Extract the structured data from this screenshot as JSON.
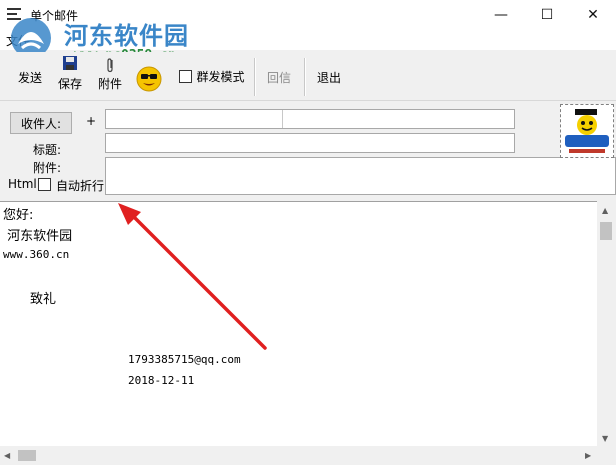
{
  "window": {
    "title": "单个邮件",
    "minimize_glyph": "—",
    "maximize_glyph": "☐",
    "close_glyph": "✕"
  },
  "menu": {
    "items": [
      {
        "label": "文件"
      }
    ]
  },
  "watermark": {
    "title": "河东软件园",
    "url": "www.pc0359.cn"
  },
  "toolbar": {
    "send_label": "发送",
    "save_label": "保存",
    "attach_label": "附件",
    "group_mode_label": "群发模式",
    "group_mode_checked": false,
    "reply_label": "回信",
    "reply_enabled": false,
    "exit_label": "退出"
  },
  "header": {
    "recipient_button_label": "收件人:",
    "plus_label": "+",
    "subject_label": "标题:",
    "attachment_label": "附件:",
    "html_label": "Html",
    "html_checked": false,
    "autowrap_label": "自动折行",
    "autowrap_checked": false,
    "recipient_value": "",
    "subject_value": "",
    "emblem_text": "Email"
  },
  "body": {
    "lines": [
      "您好:",
      " 河东软件园",
      "www.360.cn",
      "致礼",
      "1793385715@qq.com",
      "2018-12-11"
    ]
  },
  "colors": {
    "annotation_arrow": "#e02020",
    "watermark_blue": "#3a86c8",
    "watermark_green": "#2b8a3e"
  }
}
